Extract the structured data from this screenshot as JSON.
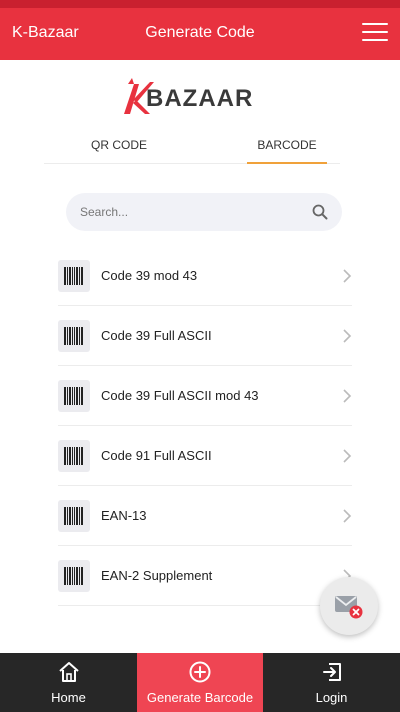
{
  "header": {
    "app_name": "K-Bazaar",
    "title": "Generate Code",
    "menu_icon": "hamburger-menu-icon",
    "color": "#e8323f"
  },
  "logo": {
    "text": "BAZAAR",
    "mark_letter": "K",
    "mark_color": "#e8323f"
  },
  "tabs": [
    {
      "label": "QR CODE",
      "active": false
    },
    {
      "label": "BARCODE",
      "active": true
    }
  ],
  "tab_active_color": "#f0a13a",
  "search": {
    "placeholder": "Search...",
    "value": "",
    "icon": "search-icon"
  },
  "barcode_types": [
    {
      "label": "Code 39 mod 43",
      "icon": "barcode-icon"
    },
    {
      "label": "Code 39 Full ASCII",
      "icon": "barcode-icon"
    },
    {
      "label": "Code 39 Full ASCII mod 43",
      "icon": "barcode-icon"
    },
    {
      "label": "Code 91 Full ASCII",
      "icon": "barcode-icon"
    },
    {
      "label": "EAN-13",
      "icon": "barcode-icon"
    },
    {
      "label": "EAN-2 Supplement",
      "icon": "barcode-icon"
    }
  ],
  "fab": {
    "icon": "mail-error-icon"
  },
  "bottom_nav": [
    {
      "label": "Home",
      "icon": "home-icon",
      "active": false
    },
    {
      "label": "Generate Barcode",
      "icon": "plus-circle-icon",
      "active": true
    },
    {
      "label": "Login",
      "icon": "login-icon",
      "active": false
    }
  ],
  "nav_active_color": "#ef4553"
}
